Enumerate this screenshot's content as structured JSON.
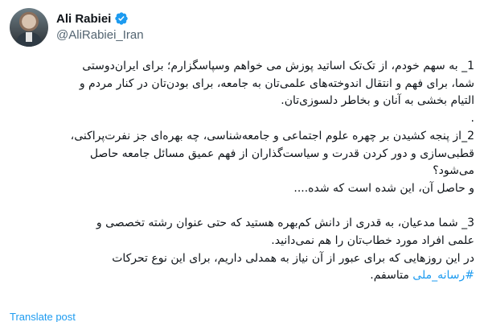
{
  "author": {
    "display_name": "Ali Rabiei",
    "handle": "@AliRabiei_Iran",
    "verified": true,
    "verified_icon": "verified-badge-icon",
    "verified_color": "#1d9bf0"
  },
  "tweet": {
    "lines": [
      "1_ به سهم خودم، از تک‌تک اساتید پوزش می خواهم وسپاسگزارم؛ برای ایران‌دوستی",
      "شما، برای فهم و انتقال اندوخته‌های علمی‌تان به جامعه، برای بودن‌تان در کنار مردم و",
      "التیام بخشی به آنان و بخاطر دلسوزی‌تان.",
      ".",
      "2_از پنجه کشیدن بر چهره علوم اجتماعی و جامعه‌شناسی، چه بهره‌ای جز نفرت‌پراکنی،",
      "قطبی‌سازی و دور کردن قدرت و سیاست‌گذاران از فهم عمیق مسائل جامعه حاصل",
      "می‌شود؟",
      "و حاصل آن، این شده است که شده....",
      "",
      "3_ شما مدعیان، به قدری از دانش کم‌بهره هستید که حتی عنوان رشته تخصصی و",
      "علمی افراد مورد خطاب‌تان را هم نمی‌دانید.",
      "در این روزهایی که برای عبور از آن نیاز به همدلی داریم، برای این نوع تحرکات"
    ],
    "last_line_hashtag": "#رسانه_ملی",
    "last_line_rest": " متاسفم."
  },
  "translate_label": "Translate post",
  "colors": {
    "text": "#0f1419",
    "secondary": "#536471",
    "accent": "#1d9bf0",
    "background": "#ffffff"
  }
}
